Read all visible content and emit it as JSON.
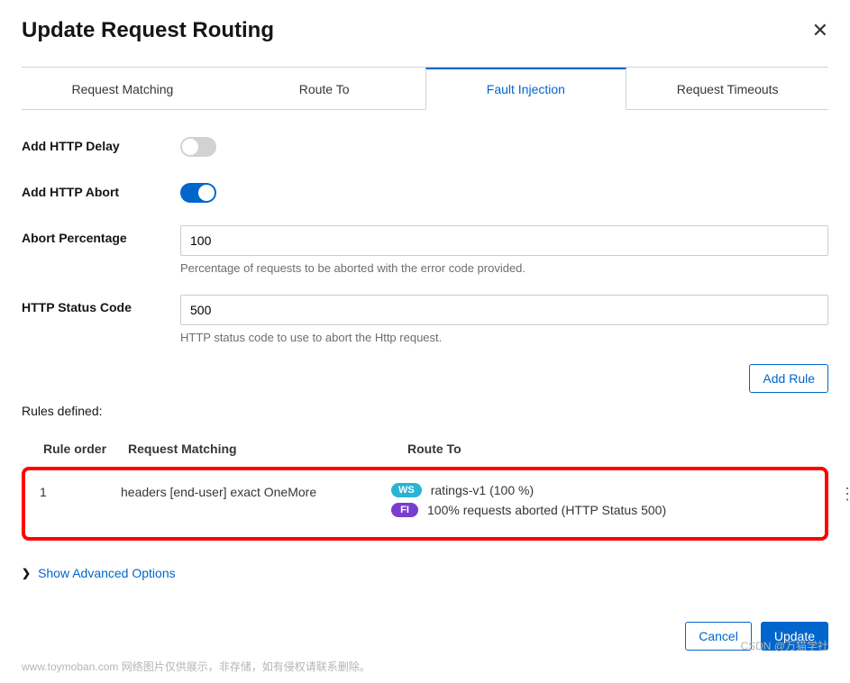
{
  "title": "Update Request Routing",
  "tabs": {
    "matching": "Request Matching",
    "route": "Route To",
    "fault": "Fault Injection",
    "timeouts": "Request Timeouts"
  },
  "form": {
    "delay_label": "Add HTTP Delay",
    "abort_label": "Add HTTP Abort",
    "abort_pct_label": "Abort Percentage",
    "abort_pct_value": "100",
    "abort_pct_help": "Percentage of requests to be aborted with the error code provided.",
    "status_label": "HTTP Status Code",
    "status_value": "500",
    "status_help": "HTTP status code to use to abort the Http request."
  },
  "add_rule": "Add Rule",
  "rules_title": "Rules defined:",
  "rules_header": {
    "order": "Rule order",
    "matching": "Request Matching",
    "route": "Route To"
  },
  "rules": {
    "r0": {
      "order": "1",
      "matching": "headers [end-user] exact OneMore",
      "ws_badge": "WS",
      "ws_text": "ratings-v1 (100 %)",
      "fi_badge": "FI",
      "fi_text": "100% requests aborted (HTTP Status 500)"
    }
  },
  "advanced": "Show Advanced Options",
  "actions": {
    "cancel": "Cancel",
    "update": "Update"
  },
  "footer": {
    "left": "www.toymoban.com  网络图片仅供展示，非存储，如有侵权请联系删除。",
    "right": "CSDN @万猫学社"
  }
}
